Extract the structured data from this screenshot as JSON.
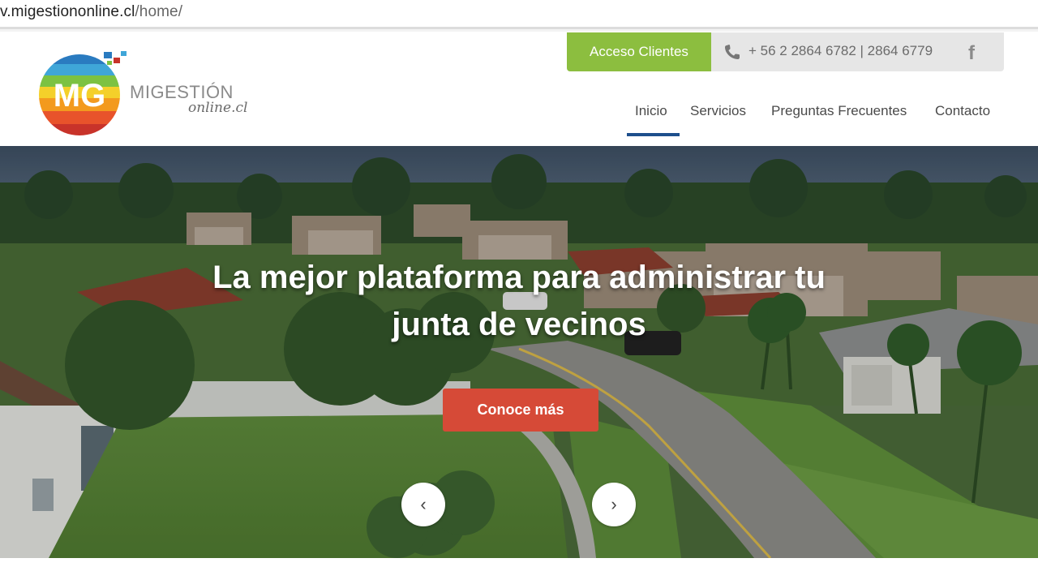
{
  "browser": {
    "url_domain": "v.migestiononline.cl",
    "url_path": "/home/"
  },
  "header": {
    "logo": {
      "monogram": "MG",
      "brand_line1": "MIGESTIÓN",
      "brand_line2": "online.cl"
    },
    "access_button_label": "Acceso Clientes",
    "phone_text": "+ 56 2 2864 6782 | 2864 6779",
    "social_icon": "facebook-icon",
    "nav": [
      {
        "label": "Inicio",
        "active": true
      },
      {
        "label": "Servicios",
        "active": false
      },
      {
        "label": "Preguntas Frecuentes",
        "active": false
      },
      {
        "label": "Contacto",
        "active": false
      }
    ]
  },
  "hero": {
    "title_line1": "La mejor plataforma para administrar tu",
    "title_line2": "junta de vecinos",
    "cta_label": "Conoce más",
    "prev_arrow": "‹",
    "next_arrow": "›"
  },
  "colors": {
    "accent_green": "#8cbe3f",
    "cta_red": "#d64a37",
    "nav_active": "#1e4f8c",
    "topbar_gray": "#e6e6e6"
  }
}
